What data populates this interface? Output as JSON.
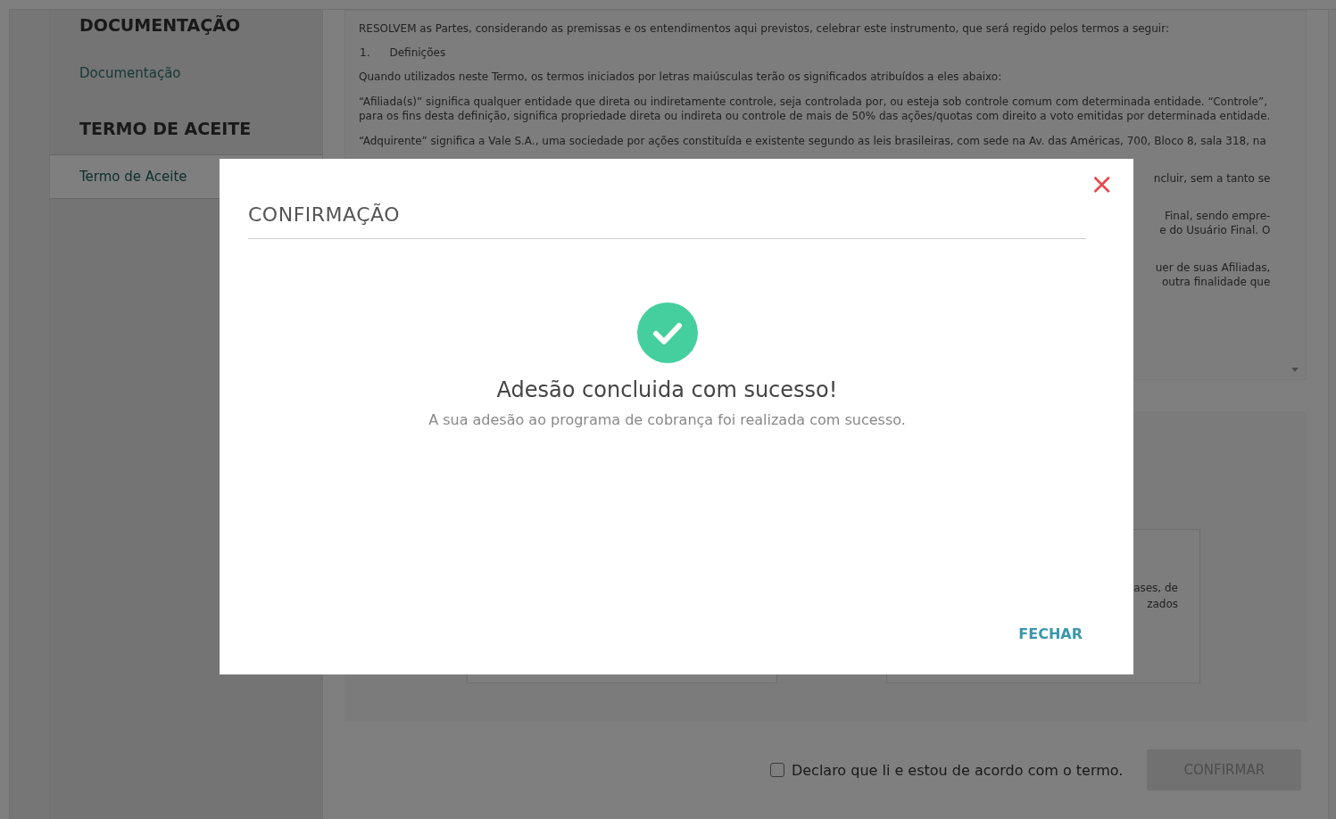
{
  "sidebar": {
    "sections": [
      {
        "title": "DOCUMENTAÇÃO",
        "items": [
          {
            "label": "Documentação",
            "selected": false
          }
        ]
      },
      {
        "title": "TERMO DE ACEITE",
        "items": [
          {
            "label": "Termo de Aceite",
            "selected": true
          }
        ]
      }
    ]
  },
  "document": {
    "paragraphs": [
      {
        "kind": "full",
        "lines": [
          "RESOLVEM as Partes, considerando as premissas e os entendimentos aqui previstos, celebrar este instrumento, que será regido pelos termos a seguir:"
        ]
      },
      {
        "kind": "heading",
        "number": "1.",
        "text": "Definições"
      },
      {
        "kind": "full",
        "lines": [
          "Quando utilizados neste Termo, os termos iniciados por letras maiúsculas terão os significados atribuídos a eles abaixo:"
        ]
      },
      {
        "kind": "full",
        "lines": [
          "“Afiliada(s)” significa qualquer entidade que direta ou indiretamente controle, seja controlada por, ou esteja sob controle comum com determinada entidade. “Controle”,",
          "para os fins desta definição, significa propriedade direta ou indireta ou controle de mais de 50% das ações/quotas com direito a voto emitidas por determinada entidade."
        ]
      },
      {
        "kind": "full",
        "lines": [
          "“Adquirente” significa a Vale S.A., uma sociedade por ações constituída e existente segundo as leis brasileiras, com sede na Av. das Américas, 700, Bloco 8, sala 318, na"
        ]
      },
      {
        "kind": "fragment",
        "lines": [
          "ncluir, sem a tanto se"
        ]
      },
      {
        "kind": "fragment",
        "lines": [
          "Final, sendo empre-",
          "e do Usuário Final. O"
        ]
      },
      {
        "kind": "fragment",
        "lines": [
          "uer de suas Afiliadas,",
          "outra finalidade que"
        ]
      }
    ]
  },
  "panel": {
    "box_lines": [
      "ases, de",
      "zados"
    ]
  },
  "agreement": {
    "label": "Declaro que li e estou de acordo com o termo.",
    "checked": false
  },
  "confirm_button": {
    "label": "CONFIRMAR",
    "disabled": true
  },
  "modal": {
    "title": "CONFIRMAÇÃO",
    "close": "×",
    "heading": "Adesão concluida com sucesso!",
    "message": "A sua adesão ao programa de cobrança foi realizada com sucesso.",
    "button": "FECHAR"
  }
}
